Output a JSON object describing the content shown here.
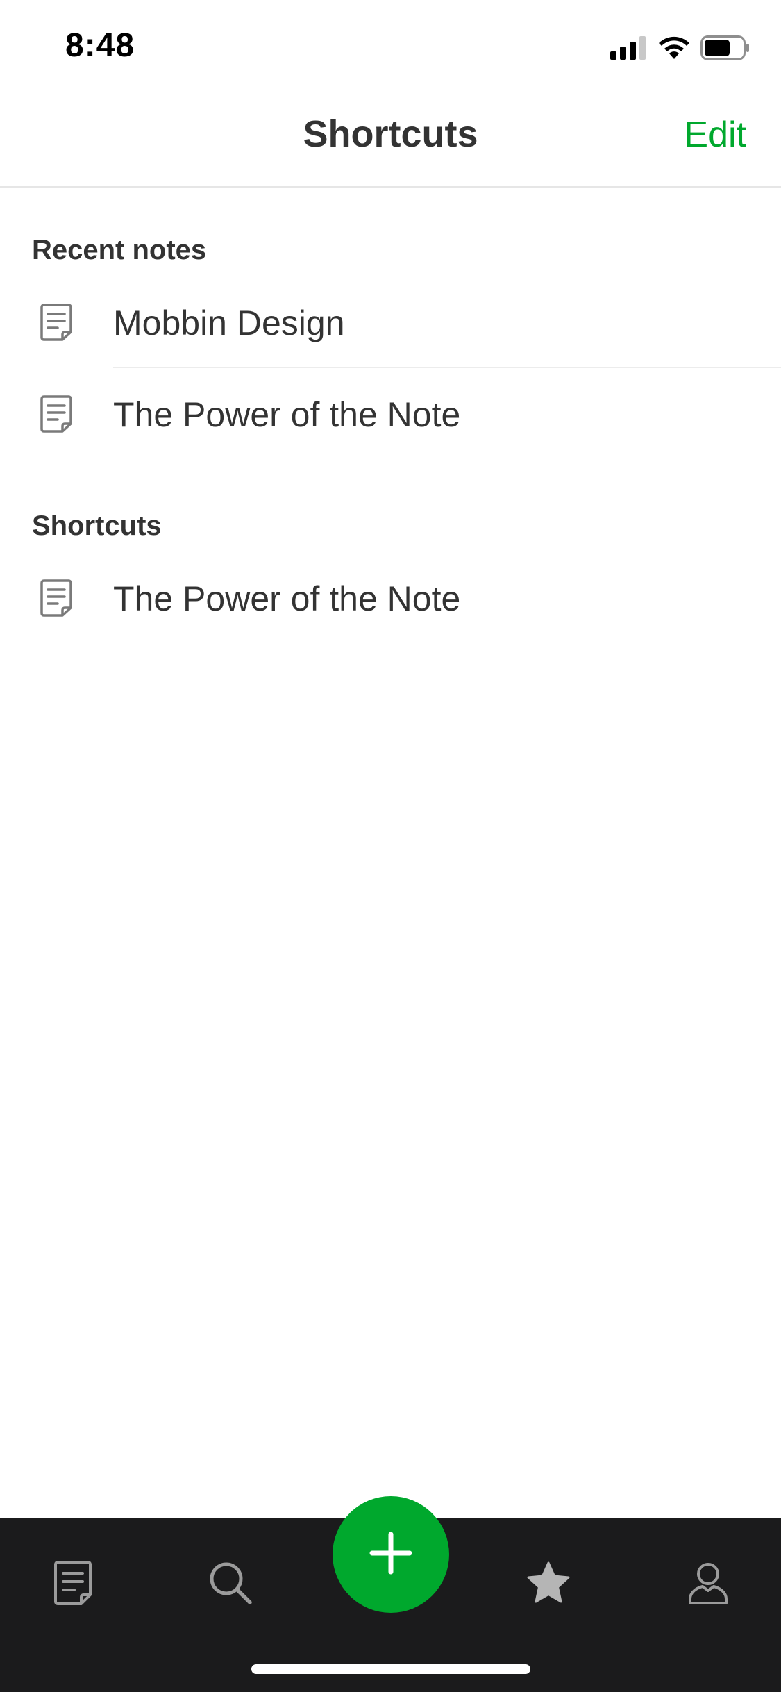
{
  "status_bar": {
    "time": "8:48",
    "icons": [
      "signal-icon",
      "wifi-icon",
      "battery-icon"
    ]
  },
  "header": {
    "title": "Shortcuts",
    "edit_label": "Edit"
  },
  "recent_notes": {
    "heading": "Recent notes",
    "items": [
      {
        "title": "Mobbin Design",
        "icon": "note-icon"
      },
      {
        "title": "The Power of the Note",
        "icon": "note-icon"
      }
    ]
  },
  "shortcuts": {
    "heading": "Shortcuts",
    "items": [
      {
        "title": "The Power of the Note",
        "icon": "note-icon"
      }
    ]
  },
  "tab_bar": {
    "tabs": [
      {
        "icon": "notes-icon"
      },
      {
        "icon": "search-icon"
      },
      {
        "icon": "add-icon"
      },
      {
        "icon": "star-icon"
      },
      {
        "icon": "account-icon"
      }
    ]
  },
  "colors": {
    "accent": "#00a82d",
    "tab_bar_bg": "#1b1b1c",
    "text": "#333333"
  }
}
